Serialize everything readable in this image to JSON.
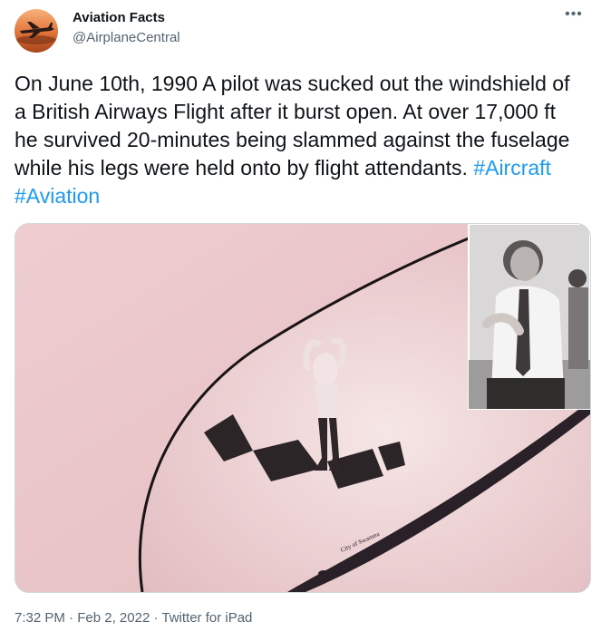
{
  "author": {
    "name": "Aviation Facts",
    "handle": "@AirplaneCentral",
    "avatar_icon": "airplane-sunset-avatar"
  },
  "more_icon": "more-horizontal-icon",
  "tweet": {
    "text": "On June 10th, 1990 A pilot was sucked out the windshield of a British Airways Flight after it burst open. At over 17,000 ft he survived 20-minutes being slammed against the fuselage while his legs were held onto by flight attendants.",
    "hashtags": [
      "#Aircraft",
      "#Aviation"
    ]
  },
  "media": {
    "icon": "photo-airplane-nose-with-pilot",
    "inset_icon": "photo-pilot-portrait"
  },
  "meta": {
    "time": "7:32 PM",
    "date": "Feb 2, 2022",
    "separator": "·",
    "source": "Twitter for iPad"
  },
  "colors": {
    "link": "#1d9bf0",
    "secondary_text": "#536471",
    "photo_tint": "#e9c8ca"
  }
}
